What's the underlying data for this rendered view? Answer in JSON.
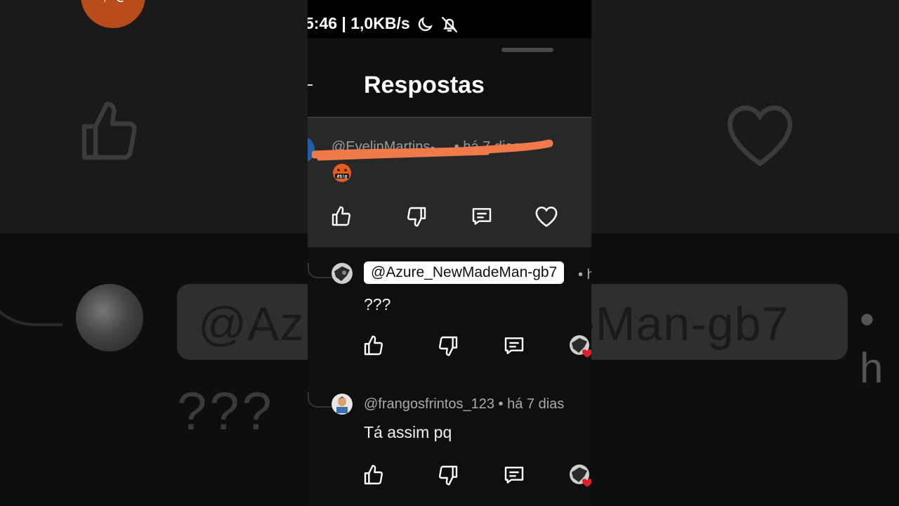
{
  "status_bar": {
    "text": "5:46 | 1,0KB/s",
    "icons": [
      "moon-icon",
      "bell-off-icon"
    ]
  },
  "sheet": {
    "title": "Respostas"
  },
  "parent_comment": {
    "author": "@EvelinMartins-__ • há 7 dias",
    "emoji": "🤬",
    "actions": [
      "like-icon",
      "dislike-icon",
      "reply-icon",
      "heart-icon"
    ]
  },
  "replies": [
    {
      "mention": "@Azure_NewMadeMan-gb7",
      "meta": "• h",
      "text": "???",
      "actions": [
        "like-icon",
        "dislike-icon",
        "reply-icon",
        "creator-heart-icon"
      ]
    },
    {
      "author": "@frangosfrintos_123 • há 7 dias",
      "text": "Tá assim pq",
      "actions": [
        "like-icon",
        "dislike-icon",
        "reply-icon",
        "creator-heart-icon"
      ]
    }
  ],
  "background": {
    "mention": "@AzureNewMadeMan-gb7",
    "question": "???",
    "emoji_text": "#$!@"
  },
  "colors": {
    "background": "#0f0f0f",
    "parent_bg": "#282828",
    "scribble": "#f07a4a",
    "accent_heart": "#e0202a",
    "avatar_blue": "#1e5fa8"
  }
}
